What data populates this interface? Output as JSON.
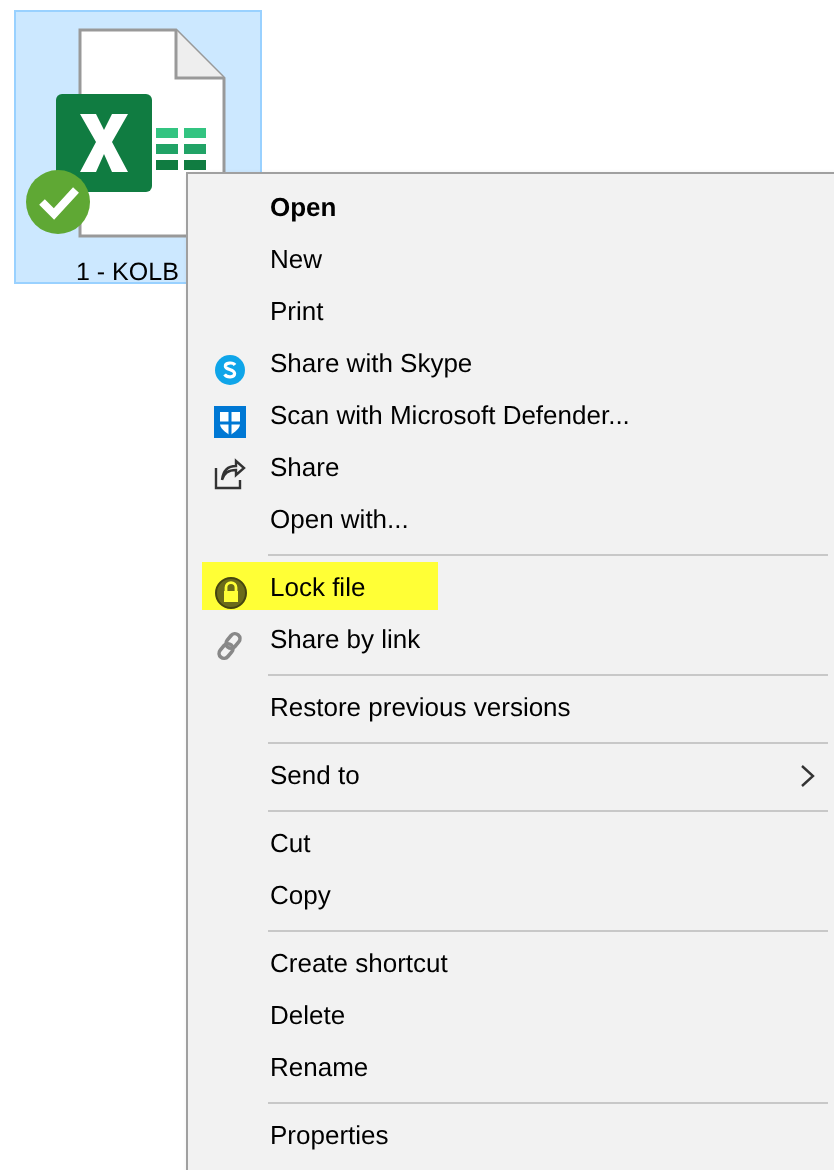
{
  "file": {
    "label": "1 - KOLB",
    "selected": true,
    "synced": true
  },
  "menu": [
    {
      "kind": "plain",
      "label": "Open",
      "bold": true
    },
    {
      "kind": "plain",
      "label": "New"
    },
    {
      "kind": "plain",
      "label": "Print"
    },
    {
      "kind": "skype",
      "label": "Share with Skype"
    },
    {
      "kind": "defender",
      "label": "Scan with Microsoft Defender..."
    },
    {
      "kind": "share",
      "label": "Share"
    },
    {
      "kind": "plain",
      "label": "Open with..."
    },
    {
      "kind": "separator"
    },
    {
      "kind": "lock",
      "label": "Lock file",
      "highlighted": true
    },
    {
      "kind": "link",
      "label": "Share by link"
    },
    {
      "kind": "separator"
    },
    {
      "kind": "plain",
      "label": "Restore previous versions"
    },
    {
      "kind": "separator"
    },
    {
      "kind": "submenu",
      "label": "Send to"
    },
    {
      "kind": "separator"
    },
    {
      "kind": "plain",
      "label": "Cut"
    },
    {
      "kind": "plain",
      "label": "Copy"
    },
    {
      "kind": "separator"
    },
    {
      "kind": "plain",
      "label": "Create shortcut"
    },
    {
      "kind": "plain",
      "label": "Delete"
    },
    {
      "kind": "plain",
      "label": "Rename"
    },
    {
      "kind": "separator"
    },
    {
      "kind": "plain",
      "label": "Properties"
    }
  ]
}
